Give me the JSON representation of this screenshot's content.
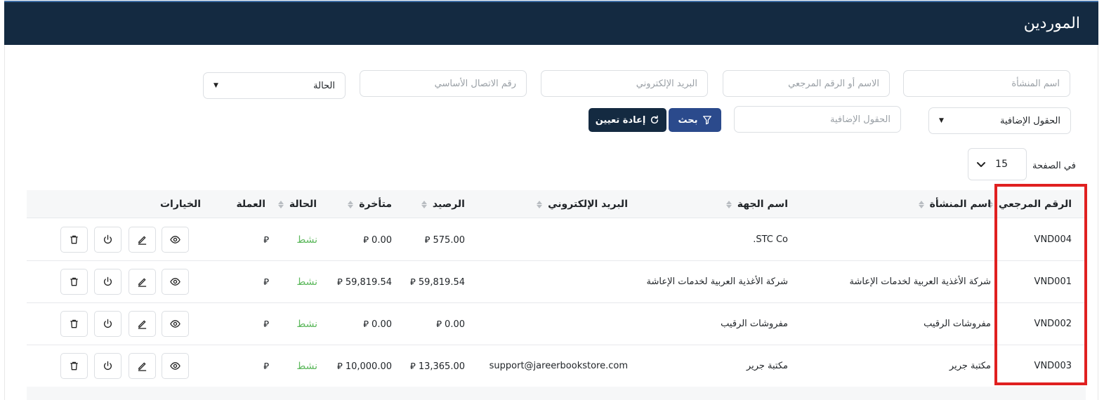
{
  "page": {
    "title": "الموردين"
  },
  "filters": {
    "establishment_name": {
      "placeholder": "اسم المنشأة"
    },
    "name_or_ref": {
      "placeholder": "الاسم أو الرقم المرجعي"
    },
    "email": {
      "placeholder": "البريد الإلكتروني"
    },
    "primary_phone": {
      "placeholder": "رقم الاتصال الأساسي"
    },
    "status": {
      "value": "الحالة"
    },
    "extra_fields_select": {
      "value": "الحقول الإضافية"
    },
    "extra_fields_input": {
      "placeholder": "الحقول الإضافية"
    },
    "search_label": "بحث",
    "reset_label": "إعادة تعيين"
  },
  "pagination": {
    "per_page_label": "في الصفحة",
    "per_page_value": "15"
  },
  "table": {
    "columns": {
      "ref": "الرقم المرجعي",
      "establishment": "اسم المنشأة",
      "entity": "اسم الجهة",
      "email": "البريد الإلكتروني",
      "balance": "الرصيد",
      "overdue": "متأخرة",
      "status": "الحالة",
      "currency": "العملة",
      "options": "الخيارات"
    },
    "rows": [
      {
        "ref": "VND004",
        "establishment": "",
        "entity": "STC Co.",
        "email": "",
        "balance": "575.00 ⃁",
        "overdue": "0.00 ⃁",
        "status": "نشط",
        "currency": "⃁"
      },
      {
        "ref": "VND001",
        "establishment": "شركة الأغذية العربية لخدمات الإعاشة",
        "entity": "شركة الأغذية العربية لخدمات الإعاشة",
        "email": "",
        "balance": "59,819.54 ⃁",
        "overdue": "59,819.54 ⃁",
        "status": "نشط",
        "currency": "⃁"
      },
      {
        "ref": "VND002",
        "establishment": "مفروشات الرقيب",
        "entity": "مفروشات الرقيب",
        "email": "",
        "balance": "0.00 ⃁",
        "overdue": "0.00 ⃁",
        "status": "نشط",
        "currency": "⃁"
      },
      {
        "ref": "VND003",
        "establishment": "مكتبة جرير",
        "entity": "مكتبة جرير",
        "email": "support@jareerbookstore.com",
        "balance": "13,365.00 ⃁",
        "overdue": "10,000.00 ⃁",
        "status": "نشط",
        "currency": "⃁"
      }
    ]
  },
  "colors": {
    "header_bg": "#142a41",
    "primary": "#2b4a8c",
    "status_active": "#5cb85c",
    "highlight": "#e02020"
  },
  "icons": {
    "view": "eye-icon",
    "edit": "pencil-icon",
    "toggle": "power-icon",
    "delete": "trash-icon",
    "filter": "filter-icon",
    "reset": "refresh-icon",
    "dropdown": "chevron-down-icon"
  }
}
